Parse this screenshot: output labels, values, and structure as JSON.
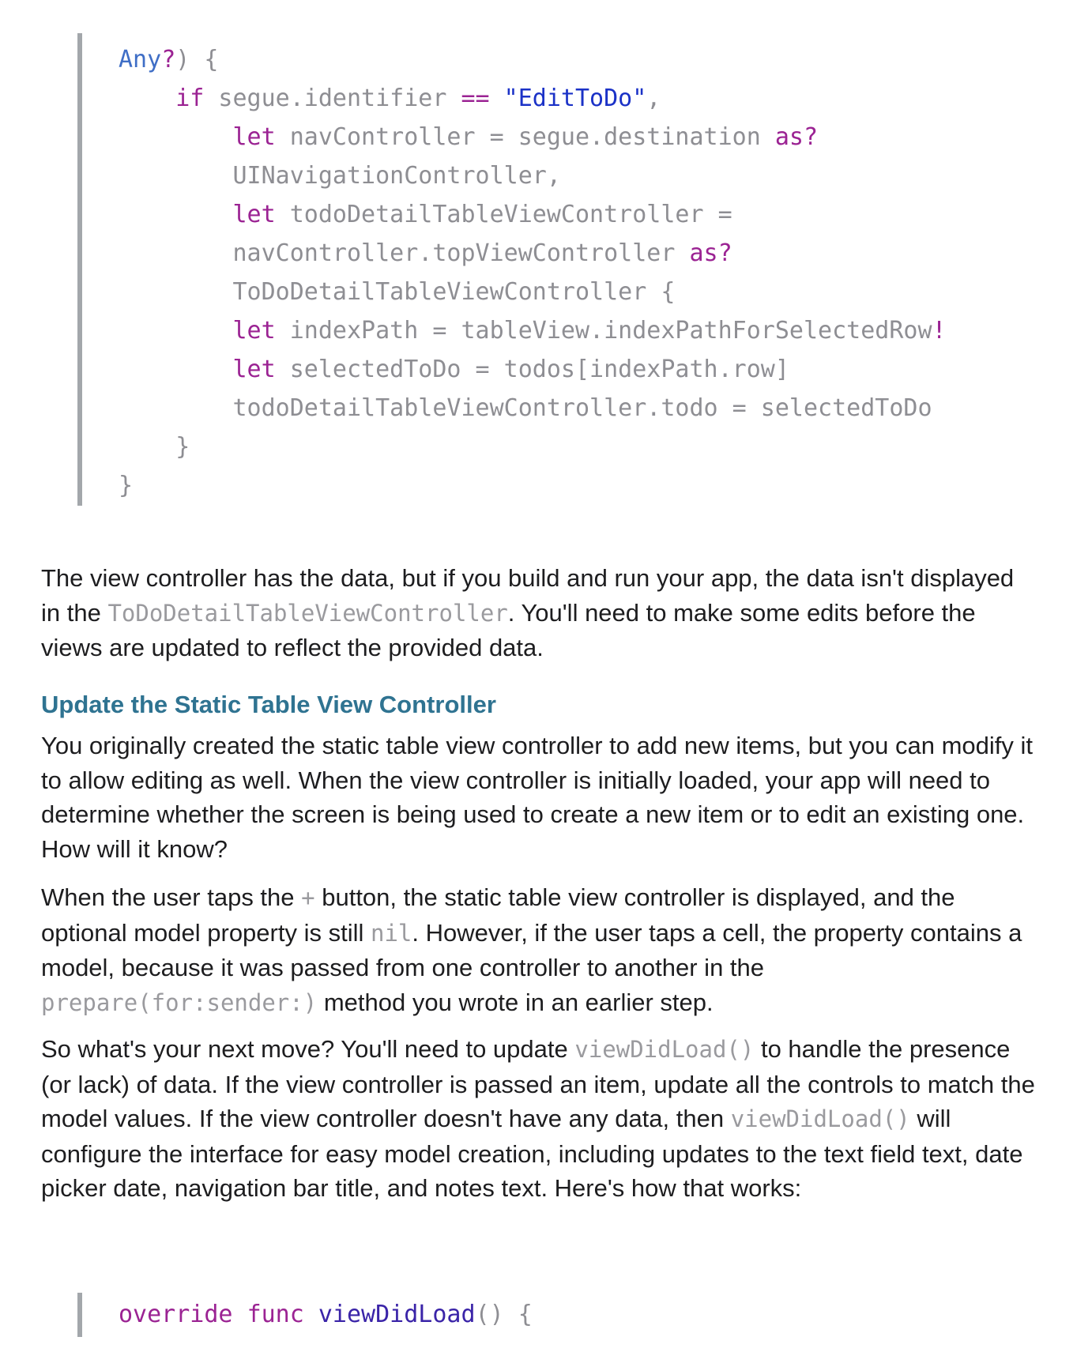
{
  "code_block_1": {
    "lines": [
      {
        "indent": "",
        "tokens": [
          {
            "t": "Any",
            "c": "ty"
          },
          {
            "t": "?",
            "c": "op"
          },
          {
            "t": ") {",
            "c": "pl"
          }
        ]
      },
      {
        "indent": "    ",
        "tokens": [
          {
            "t": "if",
            "c": "kw"
          },
          {
            "t": " segue.identifier ",
            "c": "pl"
          },
          {
            "t": "==",
            "c": "op"
          },
          {
            "t": " ",
            "c": "pl"
          },
          {
            "t": "\"EditToDo\"",
            "c": "str"
          },
          {
            "t": ",",
            "c": "pl"
          }
        ]
      },
      {
        "indent": "        ",
        "tokens": [
          {
            "t": "let",
            "c": "kw"
          },
          {
            "t": " navController = segue.destination ",
            "c": "pl"
          },
          {
            "t": "as?",
            "c": "kw"
          }
        ]
      },
      {
        "indent": "        ",
        "tokens": [
          {
            "t": "UINavigationController,",
            "c": "pl"
          }
        ]
      },
      {
        "indent": "        ",
        "tokens": [
          {
            "t": "let",
            "c": "kw"
          },
          {
            "t": " todoDetailTableViewController =",
            "c": "pl"
          }
        ]
      },
      {
        "indent": "        ",
        "tokens": [
          {
            "t": "navController.topViewController ",
            "c": "pl"
          },
          {
            "t": "as?",
            "c": "kw"
          }
        ]
      },
      {
        "indent": "        ",
        "tokens": [
          {
            "t": "ToDoDetailTableViewController {",
            "c": "pl"
          }
        ]
      },
      {
        "indent": "        ",
        "tokens": [
          {
            "t": "let",
            "c": "kw"
          },
          {
            "t": " indexPath = tableView.indexPathForSelectedRow",
            "c": "pl"
          },
          {
            "t": "!",
            "c": "op"
          }
        ]
      },
      {
        "indent": "        ",
        "tokens": [
          {
            "t": "let",
            "c": "kw"
          },
          {
            "t": " selectedToDo = todos[indexPath.row]",
            "c": "pl"
          }
        ]
      },
      {
        "indent": "        ",
        "tokens": [
          {
            "t": "todoDetailTableViewController.todo = selectedToDo",
            "c": "pl"
          }
        ]
      },
      {
        "indent": "    ",
        "tokens": [
          {
            "t": "}",
            "c": "pl"
          }
        ]
      },
      {
        "indent": "",
        "tokens": [
          {
            "t": "}",
            "c": "pl"
          }
        ]
      }
    ]
  },
  "para_1": {
    "before": "The view controller has the data, but if you build and run your app, the data isn't displayed in the ",
    "code": "ToDoDetailTableViewController",
    "after": ". You'll need to make some edits before the views are updated to reflect the provided data."
  },
  "section_heading": "Update the Static Table View Controller",
  "para_2": "You originally created the static table view controller to add new items, but you can modify it to allow editing as well. When the view controller is initially loaded, your app will need to determine whether the screen is being used to create a new item or to edit an existing one. How will it know?",
  "para_3": {
    "a": "When the user taps the ",
    "code_plus": "+",
    "b": " button, the static table view controller is displayed, and the optional model property is still ",
    "code_nil": "nil",
    "c": ". However, if the user taps a cell, the property contains a model, because it was passed from one controller to another in the ",
    "code_prepare": "prepare(for:sender:)",
    "d": " method you wrote in an earlier step."
  },
  "para_4": {
    "a": "So what's your next move? You'll need to update ",
    "code_1": "viewDidLoad()",
    "b": " to handle the presence (or lack) of data. If the view controller is passed an item, update all the controls to match the model values. If the view controller doesn't have any data, then ",
    "code_2": "viewDidLoad()",
    "c": " will configure the interface for easy model creation, including updates to the text field text, date picker date, navigation bar title, and notes text. Here's how that works:"
  },
  "code_block_2": {
    "lines": [
      {
        "indent": "",
        "tokens": [
          {
            "t": "override",
            "c": "kw"
          },
          {
            "t": " ",
            "c": "pl"
          },
          {
            "t": "func",
            "c": "kw"
          },
          {
            "t": " ",
            "c": "pl"
          },
          {
            "t": "viewDidLoad",
            "c": "fn"
          },
          {
            "t": "() {",
            "c": "pl"
          }
        ]
      }
    ]
  }
}
